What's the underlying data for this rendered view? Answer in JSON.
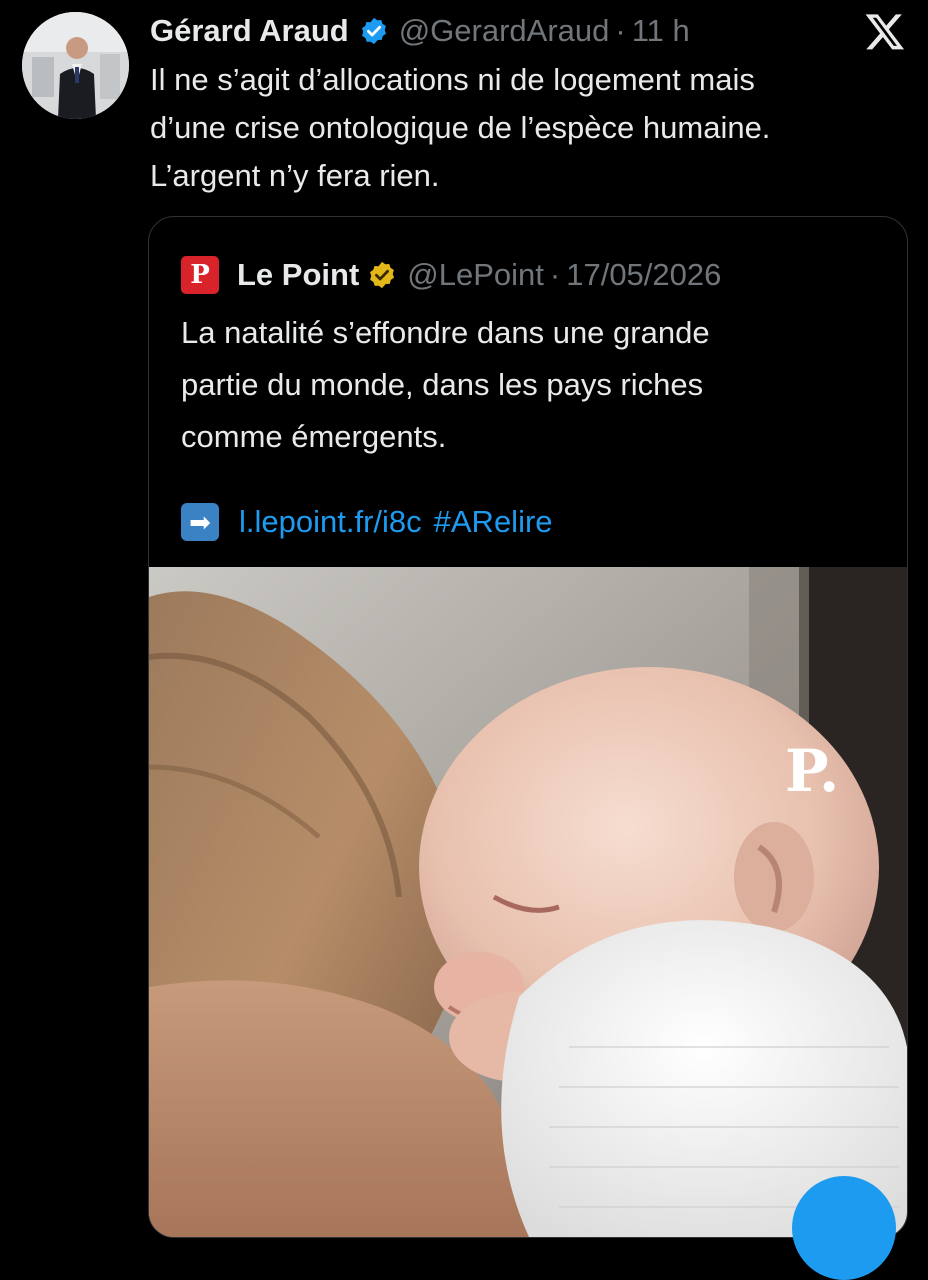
{
  "tweet": {
    "author_name": "Gérard Araud",
    "author_handle": "@GerardAraud",
    "separator": "·",
    "time": "11 h",
    "text_lines": [
      "Il ne s’agit d’allocations ni de logement mais",
      "d’une crise ontologique de l’espèce humaine.",
      "L’argent n’y fera rien."
    ],
    "verified_color": "#1d9bf0"
  },
  "app": {
    "logo_icon": "x-logo-icon"
  },
  "quote": {
    "author_name": "Le Point",
    "author_handle": "@LePoint",
    "separator": "·",
    "date": "17/05/2026",
    "logo_letter": "P",
    "logo_color": "#d8232a",
    "badge_color": "#e2b719",
    "text_lines": [
      "La natalité s’effondre dans une grande",
      "partie du monde, dans les pays riches",
      "comme émergents."
    ],
    "arrow_emoji": "➡",
    "link": "l.lepoint.fr/i8c",
    "hashtag": "#ARelire",
    "media": {
      "watermark": "P."
    }
  },
  "colors": {
    "background": "#000000",
    "text": "#e7e9ea",
    "muted": "#71767b",
    "link": "#1d9bf0",
    "border": "#2f3336"
  }
}
